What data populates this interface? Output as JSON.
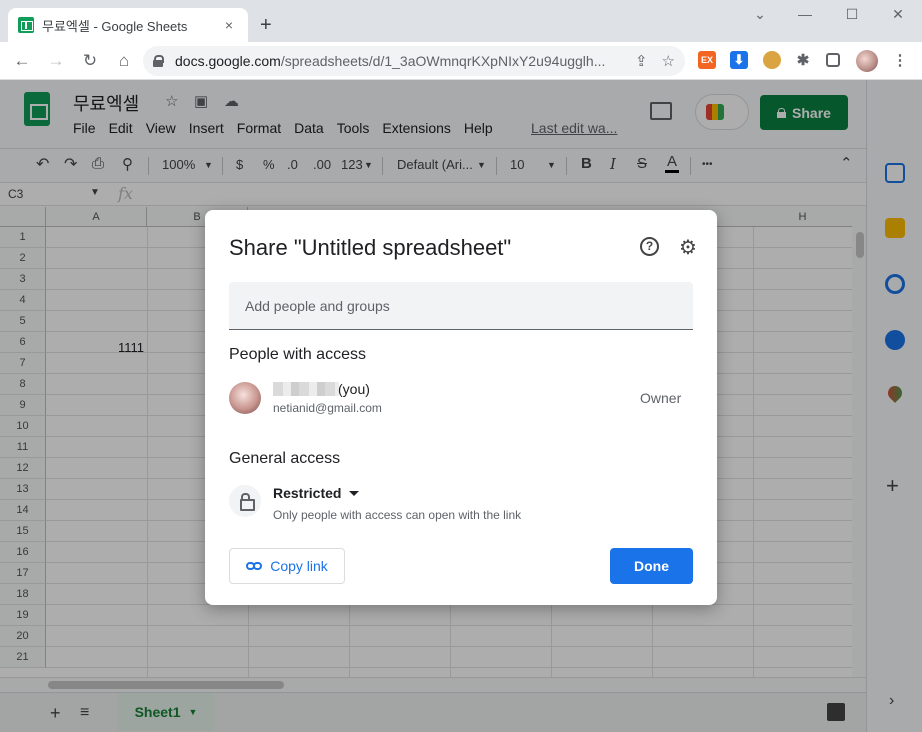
{
  "browser": {
    "tab_title": "무료엑셀 - Google Sheets",
    "tab_close": "×",
    "new_tab": "+",
    "url_host": "docs.google.com",
    "url_path": "/spreadsheets/d/1_3aOWmnqrKXpNIxY2u94ugglh..."
  },
  "sheets": {
    "doc_title": "무료엑셀",
    "menu": [
      "File",
      "Edit",
      "View",
      "Insert",
      "Format",
      "Data",
      "Tools",
      "Extensions",
      "Help"
    ],
    "last_edit": "Last edit wa...",
    "share_label": "Share",
    "format": {
      "zoom": "100%",
      "currency": "$",
      "percent": "%",
      "dec_less": ".0",
      "dec_more": ".00",
      "number_format": "123",
      "font": "Default (Ari...",
      "font_size": "10",
      "bold": "B",
      "italic": "I",
      "strike": "S",
      "text_color": "A",
      "more": "•••"
    },
    "name_box": "C3",
    "fx": "fx",
    "columns": [
      "A",
      "B",
      "H"
    ],
    "rows": [
      "1",
      "2",
      "3",
      "4",
      "5",
      "6",
      "7",
      "8",
      "9",
      "10",
      "11",
      "12",
      "13",
      "14",
      "15",
      "16",
      "17",
      "18",
      "19",
      "20",
      "21"
    ],
    "cell_a2": "1111",
    "sheet_tab": "Sheet1"
  },
  "dialog": {
    "title": "Share \"Untitled spreadsheet\"",
    "help": "?",
    "add_placeholder": "Add people and groups",
    "people_heading": "People with access",
    "you_label": "(you)",
    "email": "netianid@gmail.com",
    "role": "Owner",
    "general_heading": "General access",
    "access_level": "Restricted",
    "access_description": "Only people with access can open with the link",
    "copy_link": "Copy link",
    "done": "Done"
  },
  "colors": {
    "primary_blue": "#1a73e8",
    "share_green": "#0b8043",
    "sheets_green": "#0f9d58"
  }
}
